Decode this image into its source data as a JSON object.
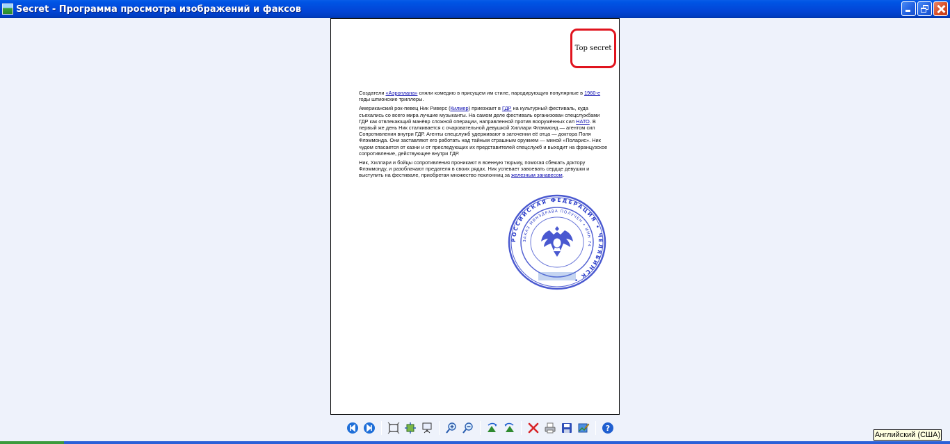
{
  "window": {
    "title": "Secret - Программа просмотра изображений и факсов"
  },
  "document": {
    "stamp_text": "Top secret",
    "paragraphs": [
      {
        "t1": "Создатели ",
        "l1": "«Аэроплана»",
        "t2": " сняли комедию в присущем им стиле, пародирующую популярные в ",
        "l2": "1960-е",
        "t3": " годы шпионские триллеры."
      },
      {
        "t1": "Американский рок-певец Ник Риверс (",
        "l1": "Килмер",
        "t2": ") приезжает в ",
        "l2": "ГДР",
        "t3": " на культурный фестиваль, куда съехались со всего мира лучшие музыканты. На самом деле фестиваль организован спецслужбами ГДР как отвлекающий манёвр сложной операции, направленной против вооружённых сил ",
        "l3": "НАТО",
        "t4": ". В первый же день Ник сталкивается с очаровательной девушкой Хиллари Флэммонд — агентом сил Сопротивления внутри ГДР. Агенты спецслужб удерживают в заточении её отца — доктора Поля Флэммонда. Они заставляют его работать над тайным страшным оружием — миной «Поларис». Ник чудом спасается от казни и от преследующих их представителей спецслужб и выходит на французское сопротивление, действующее внутри ГДР."
      },
      {
        "t1": "Ник, Хиллари и бойцы сопротивления проникают в военную тюрьму, помогая сбежать доктору Флэммонду, и разоблачают предателя в своих рядах. Ник успевает завоевать сердце девушки и выступить на фестивале, приобретая множество поклонниц за ",
        "l1": "железным занавесом",
        "t2": "."
      }
    ],
    "seal": {
      "outer_ring": "РОССИЙСКАЯ ФЕДЕРАЦИЯ • ЧЕЛЯБИНСК •",
      "inner_ring": "ЗАКАЗ МИНЗДРАВА ПОЛУЧЕН • ИНН 74",
      "description_icon": "official-seal-icon"
    }
  },
  "toolbar": {
    "buttons": [
      "prev-image-icon",
      "next-image-icon",
      "best-fit-icon",
      "actual-size-icon",
      "slideshow-icon",
      "zoom-in-icon",
      "zoom-out-icon",
      "rotate-cw-icon",
      "rotate-ccw-icon",
      "delete-icon",
      "print-icon",
      "save-icon",
      "edit-icon",
      "help-icon"
    ]
  },
  "system": {
    "language_indicator": "Английский (США)"
  },
  "colors": {
    "titlebar": "#0245d6",
    "stamp_border": "#e0141e",
    "seal_blue": "#2a3cc8",
    "link": "#0b0bb0"
  }
}
